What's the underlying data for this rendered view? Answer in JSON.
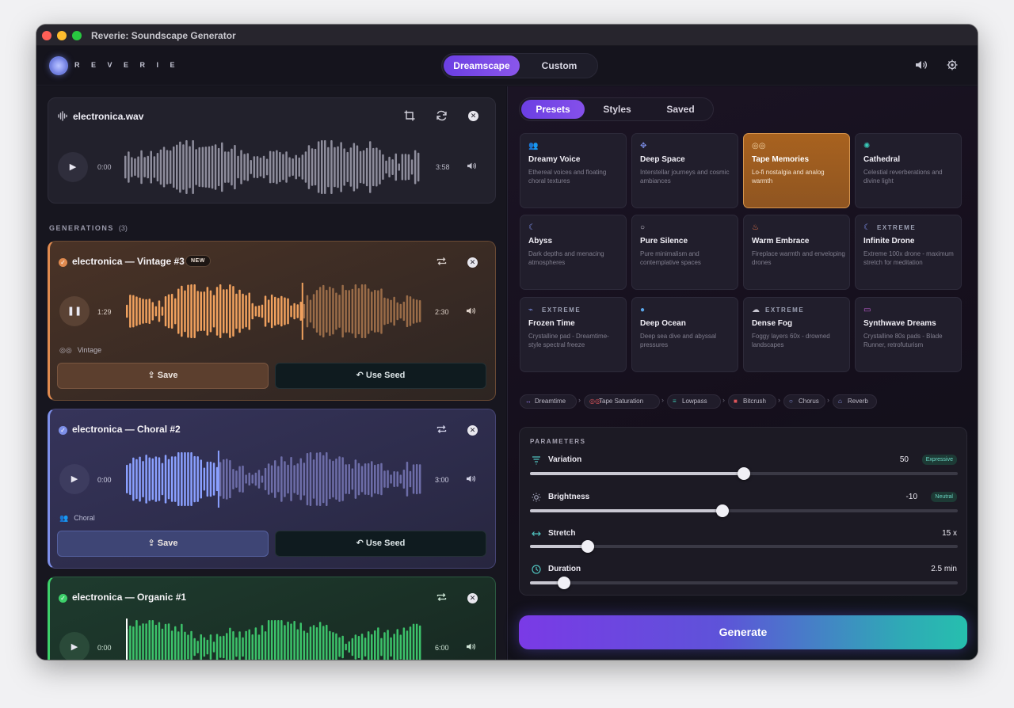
{
  "window": {
    "title": "Reverie: Soundscape Generator"
  },
  "header": {
    "logo_text": "R E V E R I E",
    "modes": [
      {
        "label": "Dreamscape",
        "active": true
      },
      {
        "label": "Custom",
        "active": false
      }
    ],
    "icons": [
      "volume-icon",
      "gear-icon"
    ]
  },
  "source": {
    "filename": "electronica.wav",
    "current_time": "0:00",
    "duration": "3:58",
    "progress": 0
  },
  "generations": {
    "label": "GENERATIONS",
    "count": "(3)",
    "items": [
      {
        "title": "electronica — Vintage #3",
        "badge": "NEW",
        "current_time": "1:29",
        "duration": "2:30",
        "progress": 0.593,
        "playing": true,
        "tag": "Vintage",
        "tag_icon": "tape-icon",
        "save_label": "Save",
        "seed_label": "Use Seed",
        "accent": "#e08a4f"
      },
      {
        "title": "electronica — Choral #2",
        "current_time": "0:00",
        "duration": "3:00",
        "progress": 0.31,
        "playing": false,
        "tag": "Choral",
        "tag_icon": "people-icon",
        "save_label": "Save",
        "seed_label": "Use Seed",
        "accent": "#7d8fe8"
      },
      {
        "title": "electronica — Organic #1",
        "current_time": "0:00",
        "duration": "6:00",
        "progress": 0,
        "playing": false,
        "accent": "#3dd06a"
      }
    ]
  },
  "tabs": [
    {
      "label": "Presets",
      "active": true
    },
    {
      "label": "Styles",
      "active": false
    },
    {
      "label": "Saved",
      "active": false
    }
  ],
  "presets": [
    {
      "name": "Dreamy Voice",
      "desc": "Ethereal voices and floating choral textures",
      "icon": "people-icon",
      "color": "#7d8fe8"
    },
    {
      "name": "Deep Space",
      "desc": "Interstellar journeys and cosmic ambiances",
      "icon": "move-icon",
      "color": "#7d8fe8"
    },
    {
      "name": "Tape Memories",
      "desc": "Lo-fi nostalgia and analog warmth",
      "icon": "tape-icon",
      "color": "#f5d6a8",
      "selected": true
    },
    {
      "name": "Cathedral",
      "desc": "Celestial reverberations and divine light",
      "icon": "sun-icon",
      "color": "#39c9b8"
    },
    {
      "name": "Abyss",
      "desc": "Dark depths and menacing atmospheres",
      "icon": "moon-icon",
      "color": "#7d8fe8"
    },
    {
      "name": "Pure Silence",
      "desc": "Pure minimalism and contemplative spaces",
      "icon": "circle-icon",
      "color": "#c7c5d1"
    },
    {
      "name": "Warm Embrace",
      "desc": "Fireplace warmth and enveloping drones",
      "icon": "flame-icon",
      "color": "#ef7a4b"
    },
    {
      "name": "Infinite Drone",
      "desc": "Extreme 100x drone - maximum stretch for meditation",
      "icon": "moon-icon",
      "color": "#7d8fe8",
      "extreme": "EXTREME"
    },
    {
      "name": "Frozen Time",
      "desc": "Crystalline pad - Dreamtime-style spectral freeze",
      "icon": "pulse-icon",
      "color": "#7d8fe8",
      "extreme": "EXTREME"
    },
    {
      "name": "Deep Ocean",
      "desc": "Deep sea dive and abyssal pressures",
      "icon": "drop-icon",
      "color": "#5aa5e8"
    },
    {
      "name": "Dense Fog",
      "desc": "Foggy layers 60x - drowned landscapes",
      "icon": "cloud-icon",
      "color": "#c7c5d1",
      "extreme": "EXTREME"
    },
    {
      "name": "Synthwave Dreams",
      "desc": "Crystalline 80s pads - Blade Runner, retrofuturism",
      "icon": "monitor-icon",
      "color": "#c45fd6"
    }
  ],
  "effect_chain": [
    {
      "label": "Dreamtime",
      "icon": "arrows-icon",
      "color": "#9a7ef0"
    },
    {
      "label": "Tape Saturation",
      "icon": "tape-icon",
      "color": "#e0565b"
    },
    {
      "label": "Lowpass",
      "icon": "filter-icon",
      "color": "#3bbba9"
    },
    {
      "label": "Bitcrush",
      "icon": "square-icon",
      "color": "#e0565b"
    },
    {
      "label": "Chorus",
      "icon": "circle-icon",
      "color": "#8e9bf0"
    },
    {
      "label": "Reverb",
      "icon": "building-icon",
      "color": "#8e9bf0"
    }
  ],
  "parameters": {
    "title": "PARAMETERS",
    "items": [
      {
        "label": "Variation",
        "value": "50",
        "badge": "Expressive",
        "level": 0.5,
        "icon": "variation-icon"
      },
      {
        "label": "Brightness",
        "value": "-10",
        "badge": "Neutral",
        "level": 0.45,
        "icon": "sun-icon"
      },
      {
        "label": "Stretch",
        "value": "15 x",
        "level": 0.135,
        "icon": "arrows-h-icon"
      },
      {
        "label": "Duration",
        "value": "2.5 min",
        "level": 0.08,
        "icon": "clock-icon"
      }
    ]
  },
  "generate_label": "Generate",
  "colors": {
    "accent_purple": "#6b3fe3",
    "vintage": "#e08a4f",
    "choral": "#7d8fe8",
    "organic": "#3dd06a",
    "teal": "#26bfae"
  }
}
